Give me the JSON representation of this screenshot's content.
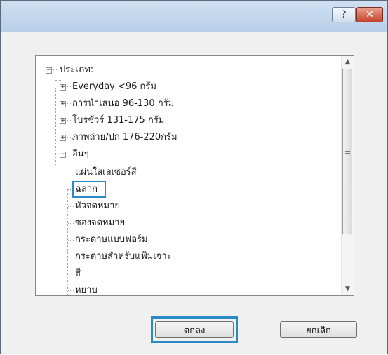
{
  "titlebar": {
    "help_label": "?",
    "close_label": "✕"
  },
  "tree": {
    "root_label": "ประเภท:",
    "items": [
      {
        "label": "Everyday <96 กรัม"
      },
      {
        "label": "การนำเสนอ 96-130 กรัม"
      },
      {
        "label": "โบรชัวร์ 131-175 กรัม"
      },
      {
        "label": "ภาพถ่าย/ปก 176-220กรัม"
      },
      {
        "label": "อื่นๆ"
      }
    ],
    "children": [
      {
        "label": "แผ่นใสเลเซอร์สี"
      },
      {
        "label": "ฉลาก",
        "selected": true
      },
      {
        "label": "หัวจดหมาย"
      },
      {
        "label": "ซองจดหมาย"
      },
      {
        "label": "กระดาษแบบฟอร์ม"
      },
      {
        "label": "กระดาษสำหรับแฟ้มเจาะ"
      },
      {
        "label": "สี"
      },
      {
        "label": "หยาบ"
      }
    ]
  },
  "buttons": {
    "ok_label": "ตกลง",
    "cancel_label": "ยกเลิก"
  },
  "colors": {
    "focus": "#2a8ac8",
    "close_button": "#c4422b"
  }
}
